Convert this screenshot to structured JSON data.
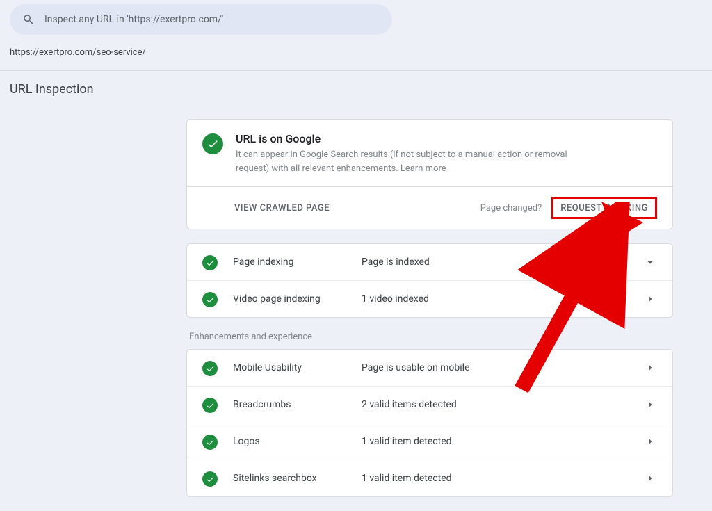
{
  "search": {
    "placeholder": "Inspect any URL in 'https://exertpro.com/'"
  },
  "url": "https://exertpro.com/seo-service/",
  "pageTitle": "URL Inspection",
  "status": {
    "title": "URL is on Google",
    "description": "It can appear in Google Search results (if not subject to a manual action or removal request) with all relevant enhancements. ",
    "learnMore": "Learn more"
  },
  "footer": {
    "viewCrawled": "VIEW CRAWLED PAGE",
    "pageChanged": "Page changed?",
    "requestIndexing": "REQUEST INDEXING"
  },
  "indexing": [
    {
      "label": "Page indexing",
      "value": "Page is indexed",
      "chevron": "down"
    },
    {
      "label": "Video page indexing",
      "value": "1 video indexed",
      "chevron": "right"
    }
  ],
  "enhancementsLabel": "Enhancements and experience",
  "enhancements": [
    {
      "label": "Mobile Usability",
      "value": "Page is usable on mobile"
    },
    {
      "label": "Breadcrumbs",
      "value": "2 valid items detected"
    },
    {
      "label": "Logos",
      "value": "1 valid item detected"
    },
    {
      "label": "Sitelinks searchbox",
      "value": "1 valid item detected"
    }
  ]
}
